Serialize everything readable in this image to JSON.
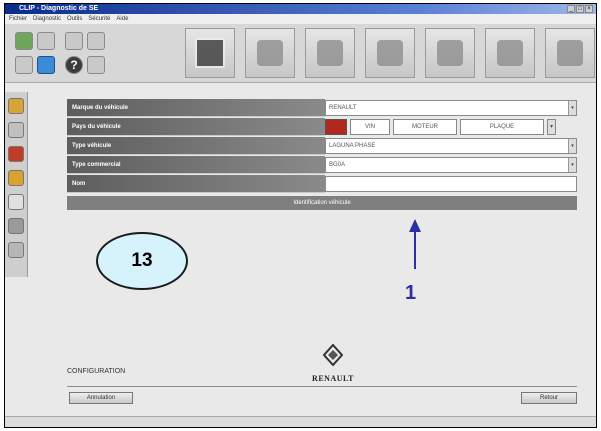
{
  "window": {
    "title": "CLIP - Diagnostic de SE",
    "controls": [
      "_",
      "□",
      "×"
    ]
  },
  "menu": {
    "items": [
      "Fichier",
      "Diagnostic",
      "Outils",
      "Sécurité",
      "Aide"
    ]
  },
  "toolbar": {
    "small_icons": [
      "home-icon",
      "arrow-icon",
      "settings-icon",
      "grid-icon",
      "car-icon",
      "monitor-icon",
      "help-icon",
      "tools-icon"
    ],
    "help_glyph": "?",
    "big_icons": [
      "vehicle-card-icon",
      "network-icon",
      "touch-icon",
      "vehicle-icon",
      "pen-icon",
      "chart-icon",
      "signature-icon"
    ]
  },
  "form": {
    "rows": [
      {
        "label": "Marque du véhicule",
        "value": "RENAULT"
      },
      {
        "label": "Pays du véhicule",
        "options": [
          "VIN",
          "MOTEUR",
          "PLAQUE"
        ]
      },
      {
        "label": "Type véhicule",
        "value": "LAGUNA PHASE"
      },
      {
        "label": "Type commercial",
        "value": "BG0A"
      },
      {
        "label": "Nom",
        "value": ""
      }
    ],
    "confirm_bar": "Identification véhicule"
  },
  "annotations": {
    "step_number": "13",
    "arrow_number": "1"
  },
  "footer": {
    "brand": "RENAULT",
    "config_note": "CONFIGURATION",
    "left_button": "Annulation",
    "right_button": "Retour"
  },
  "colors": {
    "titlebar": "#0a2d8c",
    "ellipse_fill": "#d6f3fb",
    "arrow": "#2b2f9f",
    "label_bg": "#6e6e6e"
  }
}
